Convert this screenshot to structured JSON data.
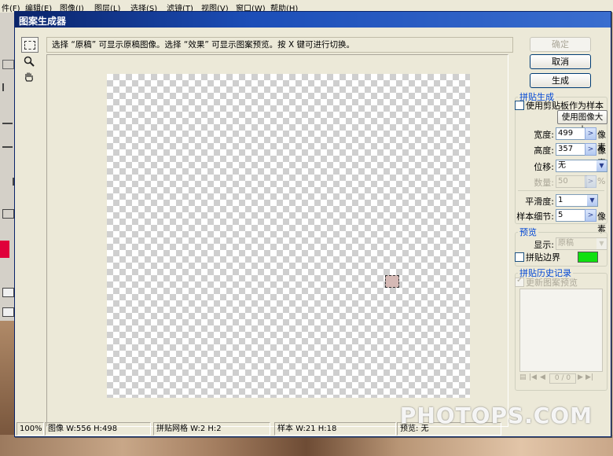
{
  "background": {
    "menu": [
      "件(F)",
      "编辑(E)",
      "图像(I)",
      "图层(L)",
      "选择(S)",
      "滤镜(T)",
      "视图(V)",
      "窗口(W)",
      "帮助(H)"
    ],
    "watermark": "PHOTOPS.COM"
  },
  "dialog": {
    "title": "图案生成器",
    "hint": "选择 “原稿” 可显示原稿图像。选择 “效果” 可显示图案预览。按 X 键可进行切换。",
    "buttons": {
      "ok": "确定",
      "cancel": "取消",
      "generate": "生成"
    },
    "tile_generation": {
      "title": "拼贴生成",
      "use_clipboard_label": "使用剪贴板作为样本",
      "use_image_size_button": "使用图像大小",
      "width_label": "宽度:",
      "width_value": "499",
      "height_label": "高度:",
      "height_value": "357",
      "px_unit": "像素",
      "offset_label": "位移:",
      "offset_value": "无",
      "amount_label": "数量:",
      "amount_value": "50",
      "percent_unit": "%",
      "smoothness_label": "平滑度:",
      "smoothness_value": "1",
      "sample_detail_label": "样本细节:",
      "sample_detail_value": "5"
    },
    "preview_group": {
      "title": "预览",
      "show_label": "显示:",
      "show_value": "原稿",
      "tile_boundaries_label": "拼贴边界",
      "tile_boundary_color": "#10e010"
    },
    "history": {
      "title": "拼贴历史记录",
      "update_label": "更新图案预览",
      "counter": "0 / 0"
    },
    "status": {
      "zoom": "100%",
      "image_size": "图像 W:556 H:498",
      "tile_grid": "拼贴网格 W:2 H:2",
      "sample_size": "样本 W:21 H:18",
      "preview_label": "预览:",
      "preview_value": "无"
    }
  }
}
